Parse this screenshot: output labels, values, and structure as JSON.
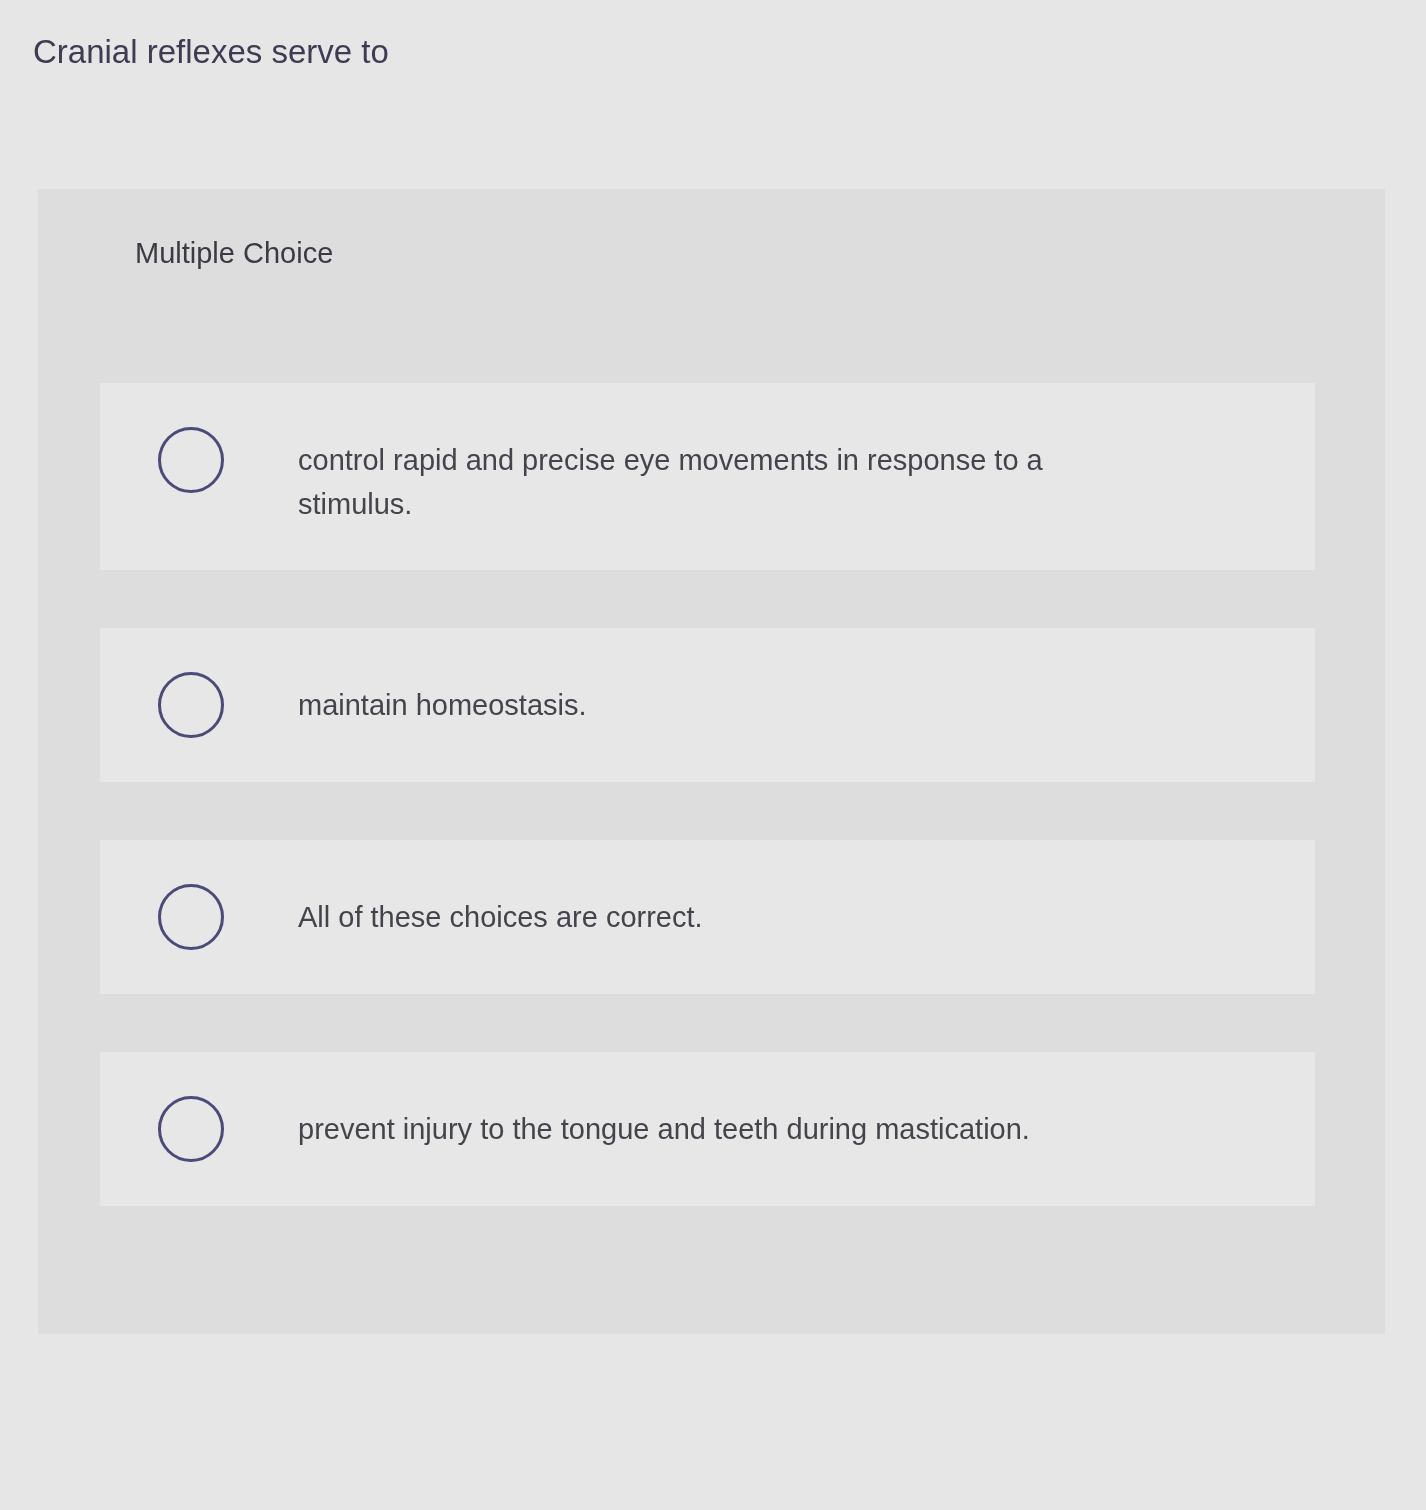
{
  "question": "Cranial reflexes serve to",
  "panel": {
    "label": "Multiple Choice"
  },
  "options": [
    {
      "text": "control rapid and precise eye movements in response to a stimulus.",
      "selected": false
    },
    {
      "text": "maintain homeostasis.",
      "selected": false
    },
    {
      "text": "All of these choices are correct.",
      "selected": false
    },
    {
      "text": "prevent injury to the tongue and teeth during mastication.",
      "selected": false
    }
  ]
}
